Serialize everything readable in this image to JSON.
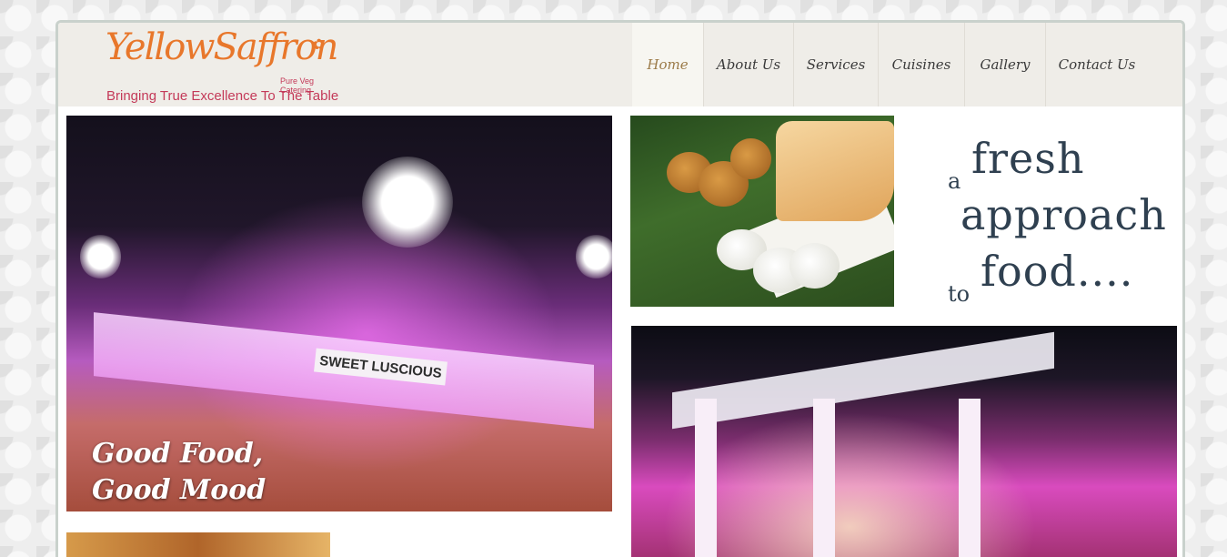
{
  "logo": {
    "wordmark": "YellowSaffron",
    "sub": "Pure Veg Catering",
    "tagline": "Bringing True Excellence To The Table"
  },
  "nav": {
    "items": [
      {
        "label": "Home",
        "active": true
      },
      {
        "label": "About Us",
        "active": false
      },
      {
        "label": "Services",
        "active": false
      },
      {
        "label": "Cuisines",
        "active": false
      },
      {
        "label": "Gallery",
        "active": false
      },
      {
        "label": "Contact Us",
        "active": false
      }
    ]
  },
  "hero": {
    "sign": "SWEET LUSCIOUS",
    "caption_line1": "Good Food,",
    "caption_line2": "Good Mood"
  },
  "tagline": {
    "a": "a",
    "fresh": "fresh",
    "approach": "approach",
    "to": "to",
    "food": "food...."
  },
  "colors": {
    "logo_orange": "#e8772b",
    "logo_pink": "#c43a59",
    "header_bg": "#efede8",
    "nav_active": "#9b7a48",
    "tagline_text": "#2f4050"
  }
}
